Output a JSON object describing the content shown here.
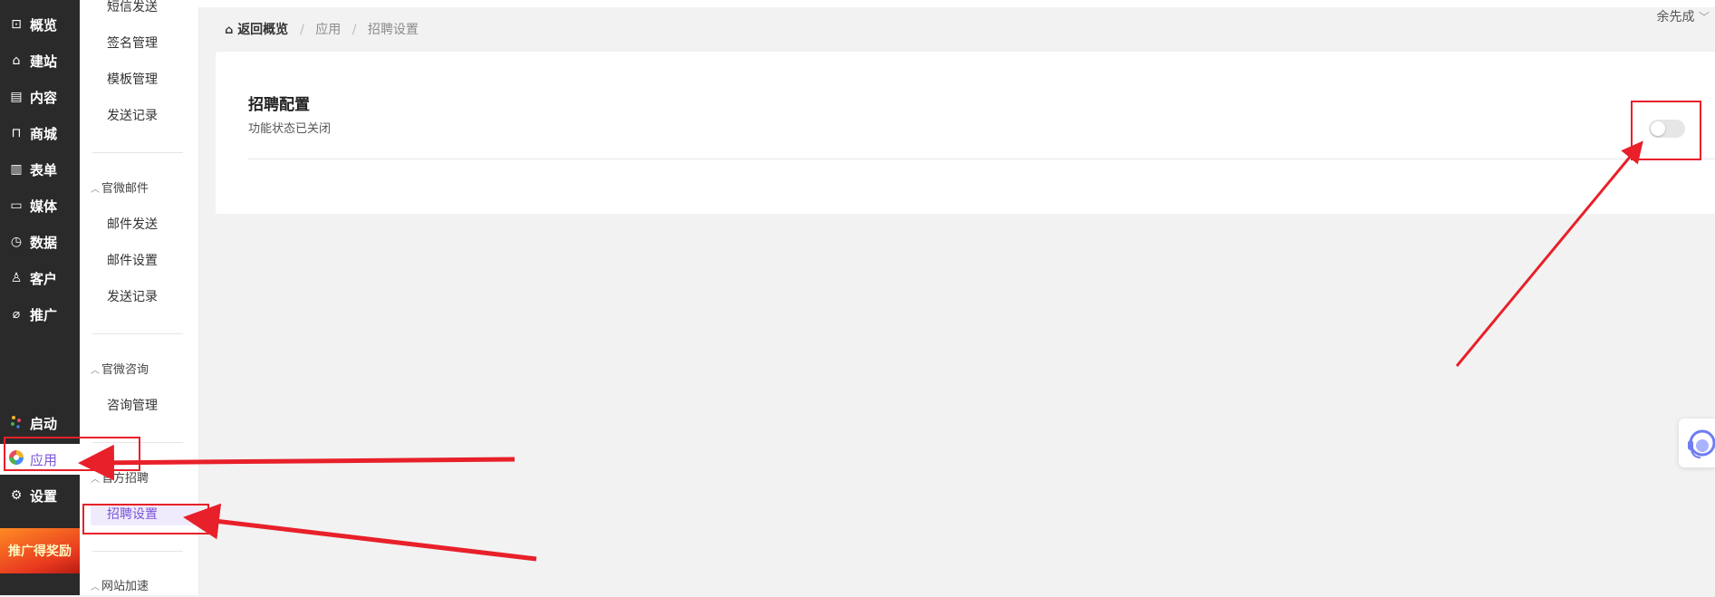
{
  "nav": {
    "items": [
      {
        "label": "概览",
        "icon": "dashboard-icon",
        "glyph": "⌂"
      },
      {
        "label": "建站",
        "icon": "home-icon",
        "glyph": "⌂"
      },
      {
        "label": "内容",
        "icon": "document-icon",
        "glyph": "▤"
      },
      {
        "label": "商城",
        "icon": "cart-icon",
        "glyph": "⊓"
      },
      {
        "label": "表单",
        "icon": "form-icon",
        "glyph": "▥"
      },
      {
        "label": "媒体",
        "icon": "video-icon",
        "glyph": "▭"
      },
      {
        "label": "数据",
        "icon": "clock-icon",
        "glyph": "◷"
      },
      {
        "label": "客户",
        "icon": "user-icon",
        "glyph": "♙"
      },
      {
        "label": "推广",
        "icon": "paperclip-icon",
        "glyph": "⌀"
      },
      {
        "label": "启动",
        "icon": "launch-dots-icon",
        "glyph": "⁘"
      },
      {
        "label": "应用",
        "icon": "apps-pinwheel-icon",
        "glyph": "✿"
      },
      {
        "label": "设置",
        "icon": "gear-icon",
        "glyph": "⚙"
      }
    ],
    "active_label": "应用",
    "promo_label": "推广得奖励"
  },
  "sub": {
    "items_sms": [
      "短信发送",
      "签名管理",
      "模板管理",
      "发送记录"
    ],
    "group_mail": "官微邮件",
    "items_mail": [
      "邮件发送",
      "邮件设置",
      "发送记录"
    ],
    "group_consult": "官微咨询",
    "items_consult": [
      "咨询管理"
    ],
    "group_recruit": "官方招聘",
    "items_recruit": [
      "招聘设置"
    ],
    "group_speed": "网站加速"
  },
  "header": {
    "user_name": "余先成",
    "chevron": "﹀"
  },
  "breadcrumb": {
    "home": "返回概览",
    "items": [
      "应用",
      "招聘设置"
    ],
    "separator": "/"
  },
  "card": {
    "title": "招聘配置",
    "status": "功能状态已关闭",
    "toggle_on": false
  },
  "colors": {
    "accent": "#7b55d8",
    "annotation": "#e8202a",
    "nav_bg": "#2a2a2a"
  }
}
